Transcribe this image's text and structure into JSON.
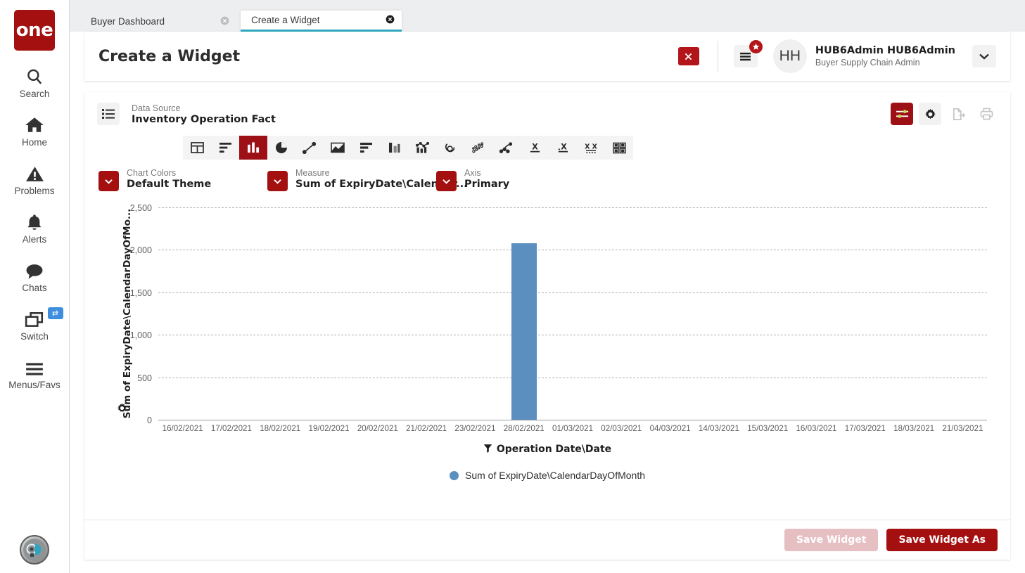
{
  "brand": {
    "logo_text": "one"
  },
  "rail": {
    "items": [
      {
        "label": "Search",
        "icon": "search-icon"
      },
      {
        "label": "Home",
        "icon": "home-icon"
      },
      {
        "label": "Problems",
        "icon": "warning-triangle-icon"
      },
      {
        "label": "Alerts",
        "icon": "bell-icon"
      },
      {
        "label": "Chats",
        "icon": "chat-bubble-icon"
      },
      {
        "label": "Switch",
        "icon": "windows-stack-icon",
        "badge_icon": "swap-arrows-icon"
      },
      {
        "label": "Menus/Favs",
        "icon": "hamburger-icon"
      }
    ],
    "avatar_icon": "assistant-head-icon"
  },
  "tabs": [
    {
      "label": "Buyer Dashboard",
      "close_icon": "close-circle-icon",
      "active": false
    },
    {
      "label": "Create a Widget",
      "close_icon": "close-circle-icon",
      "active": true
    }
  ],
  "header": {
    "title": "Create a Widget",
    "close_button_icon": "x-icon",
    "menu_icon": "list-menu-icon",
    "menu_badge_icon": "star-icon",
    "avatar_initials": "HH",
    "user_name": "HUB6Admin HUB6Admin",
    "user_role": "Buyer Supply Chain Admin",
    "dropdown_icon": "chevron-down-icon"
  },
  "data_source": {
    "icon": "list-icon",
    "label": "Data Source",
    "value": "Inventory Operation Fact",
    "actions": [
      {
        "name": "filters-toggle-icon",
        "state": "active"
      },
      {
        "name": "gear-icon",
        "state": "plain"
      },
      {
        "name": "export-icon",
        "state": "ghost"
      },
      {
        "name": "print-icon",
        "state": "ghost"
      }
    ]
  },
  "chart_types": [
    {
      "icon": "table-icon",
      "selected": false
    },
    {
      "icon": "horizontal-bar-icon",
      "selected": false
    },
    {
      "icon": "column-bar-icon",
      "selected": true
    },
    {
      "icon": "pie-icon",
      "selected": false
    },
    {
      "icon": "line-icon",
      "selected": false
    },
    {
      "icon": "area-icon",
      "selected": false
    },
    {
      "icon": "stacked-bar-icon",
      "selected": false
    },
    {
      "icon": "range-column-icon",
      "selected": false
    },
    {
      "icon": "combo-chart-icon",
      "selected": false
    },
    {
      "icon": "spiral-icon",
      "selected": false
    },
    {
      "icon": "bubble-icon",
      "selected": false
    },
    {
      "icon": "scatter-line-icon",
      "selected": false
    },
    {
      "icon": "x-underline-icon",
      "selected": false
    },
    {
      "icon": "x-dotted-icon",
      "selected": false
    },
    {
      "icon": "xx-dotted-icon",
      "selected": false
    },
    {
      "icon": "grid-matrix-icon",
      "selected": false
    }
  ],
  "selectors": [
    {
      "label": "Chart Colors",
      "value": "Default Theme",
      "chevron": "chevron-down-icon"
    },
    {
      "label": "Measure",
      "value": "Sum of ExpiryDate\\Calendar...",
      "chevron": "chevron-down-icon"
    },
    {
      "label": "Axis",
      "value": "Primary",
      "chevron": "chevron-down-icon"
    }
  ],
  "chart_settings_icon": "gear-icon",
  "footer": {
    "save_label": "Save Widget",
    "save_as_label": "Save Widget As"
  },
  "colors": {
    "brand_red": "#a40f10",
    "bar_blue": "#5b8fbf",
    "active_tab_underline": "#2fa8c0",
    "badge_blue": "#3e8edd"
  },
  "chart_data": {
    "type": "bar",
    "title": "",
    "xlabel": "Operation Date\\Date",
    "ylabel": "Sum of ExpiryDate\\CalendarDayOfMo...",
    "ylabel_full": "Sum of ExpiryDate\\CalendarDayOfMonth",
    "ylim": [
      0,
      2500
    ],
    "yticks": [
      0,
      500,
      1000,
      1500,
      2000,
      2500
    ],
    "ytick_labels": [
      "0",
      "500",
      "1,000",
      "1,500",
      "2,000",
      "2,500"
    ],
    "grid": true,
    "legend_position": "bottom",
    "legend": [
      "Sum of ExpiryDate\\CalendarDayOfMonth"
    ],
    "categories": [
      "16/02/2021",
      "17/02/2021",
      "18/02/2021",
      "19/02/2021",
      "20/02/2021",
      "21/02/2021",
      "23/02/2021",
      "28/02/2021",
      "01/03/2021",
      "02/03/2021",
      "04/03/2021",
      "14/03/2021",
      "15/03/2021",
      "16/03/2021",
      "17/03/2021",
      "18/03/2021",
      "21/03/2021"
    ],
    "series": [
      {
        "name": "Sum of ExpiryDate\\CalendarDayOfMonth",
        "color": "#5b8fbf",
        "values": [
          0,
          0,
          0,
          0,
          0,
          0,
          0,
          2075,
          0,
          0,
          0,
          0,
          0,
          0,
          0,
          0,
          0
        ]
      }
    ]
  }
}
